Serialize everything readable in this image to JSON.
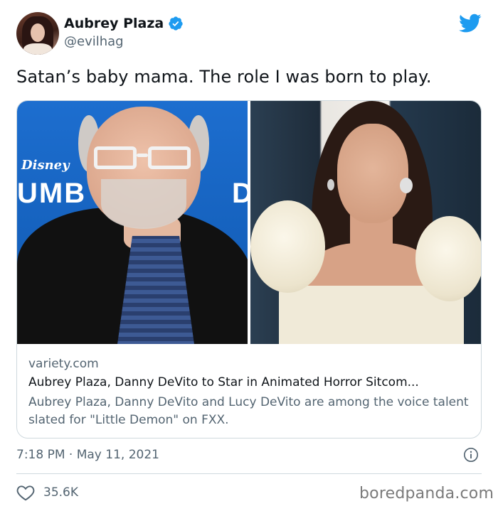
{
  "author": {
    "display_name": "Aubrey Plaza",
    "handle": "@evilhag",
    "verified": true
  },
  "tweet": {
    "text": "Satan’s baby mama. The role I was born to play."
  },
  "card": {
    "images": {
      "left": {
        "logo_text": "Disney",
        "background_letters": "UMB",
        "background_letter_right": "D"
      }
    },
    "domain": "variety.com",
    "title": "Aubrey Plaza, Danny DeVito to Star in Animated Horror Sitcom...",
    "description": "Aubrey Plaza, Danny DeVito and Lucy DeVito are among the voice talent slated for \"Little Demon\" on FXX."
  },
  "meta": {
    "timestamp": "7:18 PM · May 11, 2021"
  },
  "engagement": {
    "likes": "35.6K"
  },
  "watermark": "boredpanda.com",
  "icons": {
    "verified": "verified-badge-icon",
    "platform": "twitter-bird-icon",
    "info": "info-icon",
    "like": "heart-icon"
  },
  "colors": {
    "brand_blue": "#1d9bf0",
    "text_primary": "#0f1419",
    "text_secondary": "#536471",
    "border": "#cfd9de"
  }
}
